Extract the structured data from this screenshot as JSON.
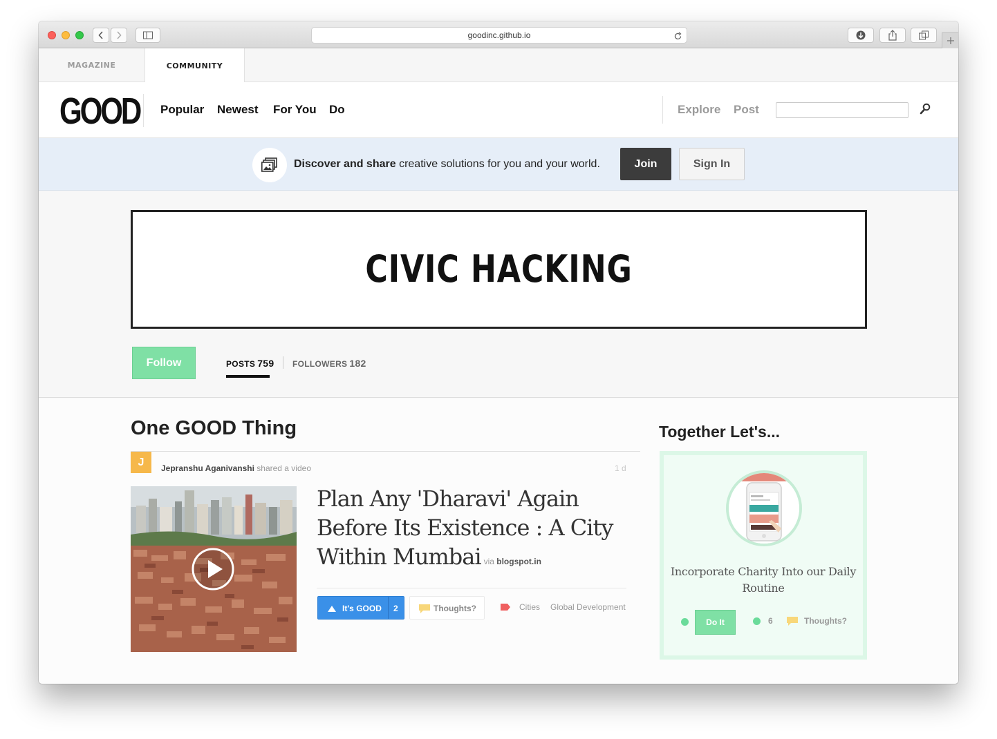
{
  "browser": {
    "url": "goodinc.github.io"
  },
  "top_tabs": {
    "magazine": "MAGAZINE",
    "community": "COMMUNITY"
  },
  "header": {
    "logo": "GOOD",
    "nav": [
      "Popular",
      "Newest",
      "For You",
      "Do"
    ],
    "explore": "Explore",
    "post": "Post",
    "search_placeholder": ""
  },
  "banner": {
    "text_bold": "Discover and share",
    "text_rest": " creative solutions for you and your world.",
    "join": "Join",
    "sign_in": "Sign In"
  },
  "community": {
    "title": "CIVIC HACKING",
    "follow": "Follow",
    "posts_label": "POSTS",
    "posts_count": "759",
    "followers_label": "FOLLOWERS",
    "followers_count": "182"
  },
  "feed": {
    "section_title": "One GOOD Thing",
    "post": {
      "avatar_letter": "J",
      "author": "Jepranshu Aganivanshi",
      "action": " shared a video",
      "time": "1 d",
      "title": "Plan Any 'Dharavi' Again Before Its Existence : A City Within Mumbai",
      "via_label": "via",
      "via_source": "blogspot.in",
      "good_label": "It's GOOD",
      "good_count": "2",
      "thoughts_label": "Thoughts?",
      "tags": [
        "Cities",
        "Global Development"
      ]
    }
  },
  "sidebar": {
    "title": "Together Let's...",
    "card_text": "Incorporate Charity Into our Daily Routine",
    "do_it": "Do It",
    "count": "6",
    "thoughts": "Thoughts?"
  },
  "colors": {
    "accent_green": "#7fe0a5",
    "good_blue": "#3a90e8",
    "banner_bg": "#e6eef8",
    "avatar_orange": "#f6b84a"
  }
}
